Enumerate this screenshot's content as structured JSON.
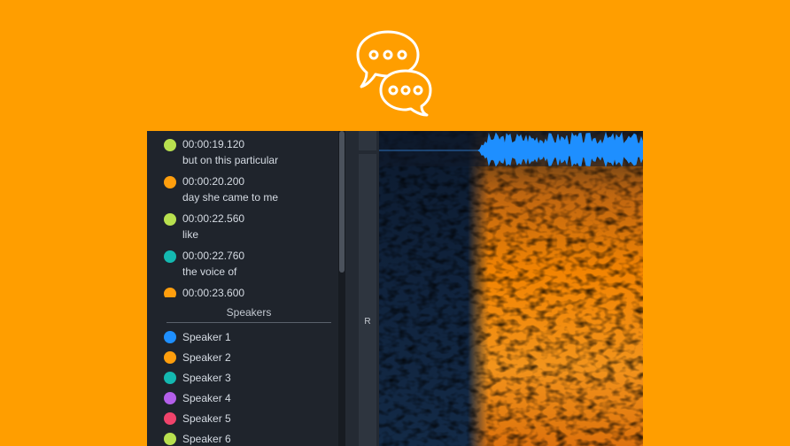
{
  "transcript": {
    "entries": [
      {
        "time": "00:00:19.120",
        "text": "but on this particular",
        "color": "#B8E04F"
      },
      {
        "time": "00:00:20.200",
        "text": "day she came to me",
        "color": "#FF9E0D"
      },
      {
        "time": "00:00:22.560",
        "text": "like",
        "color": "#B8E04F"
      },
      {
        "time": "00:00:22.760",
        "text": "the voice of",
        "color": "#14B8B0"
      },
      {
        "time": "00:00:23.600",
        "text": "",
        "color": "#FF9E0D"
      }
    ]
  },
  "speakers": {
    "title": "Speakers",
    "items": [
      {
        "label": "Speaker 1",
        "color": "#1E8FFF"
      },
      {
        "label": "Speaker 2",
        "color": "#FF9E0D"
      },
      {
        "label": "Speaker 3",
        "color": "#14B8B0"
      },
      {
        "label": "Speaker 4",
        "color": "#B45FEA"
      },
      {
        "label": "Speaker 5",
        "color": "#F0436B"
      },
      {
        "label": "Speaker 6",
        "color": "#B8E04F"
      }
    ]
  },
  "channel": {
    "label": "R"
  },
  "colors": {
    "background": "#FF9E00",
    "waveform": "#1E8FFF",
    "spectrogram_hot": "#FF8A00",
    "spectrogram_cold": "#0E1D33"
  },
  "icons": {
    "header": "chat-bubbles-icon"
  }
}
